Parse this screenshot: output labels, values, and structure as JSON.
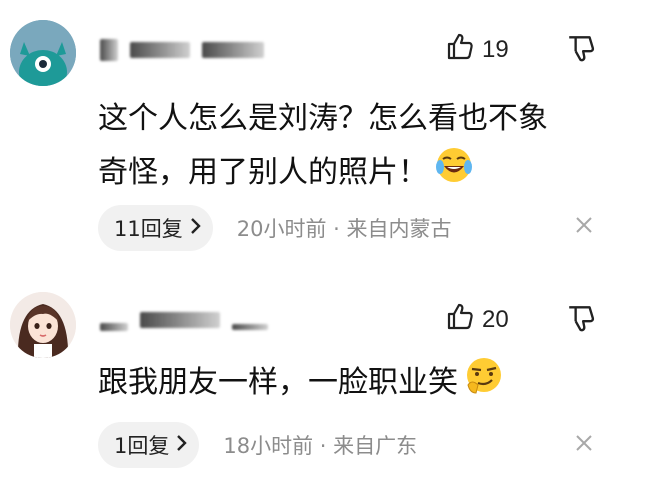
{
  "comments": [
    {
      "avatar": "teal-cartoon-avatar-icon",
      "likes": "19",
      "text_line1": "这个人怎么是刘涛？怎么看也不象",
      "text_line2": "奇怪，用了别人的照片！",
      "emoji": "crying-laughing-emoji",
      "reply_label": "11回复",
      "time_location": "20小时前 · 来自内蒙古"
    },
    {
      "avatar": "girl-portrait-avatar-icon",
      "likes": "20",
      "text_line1": "跟我朋友一样，一脸职业笑",
      "emoji": "smirking-emoji",
      "reply_label": "1回复",
      "time_location": "18小时前 · 来自广东"
    }
  ],
  "icons": {
    "thumbs_up": "thumbs-up-icon",
    "thumbs_down": "thumbs-down-icon",
    "close": "close-icon",
    "chevron": "chevron-right-icon"
  },
  "colors": {
    "meta_text": "#8c8c8c",
    "pill_bg": "#f1f1f1"
  }
}
